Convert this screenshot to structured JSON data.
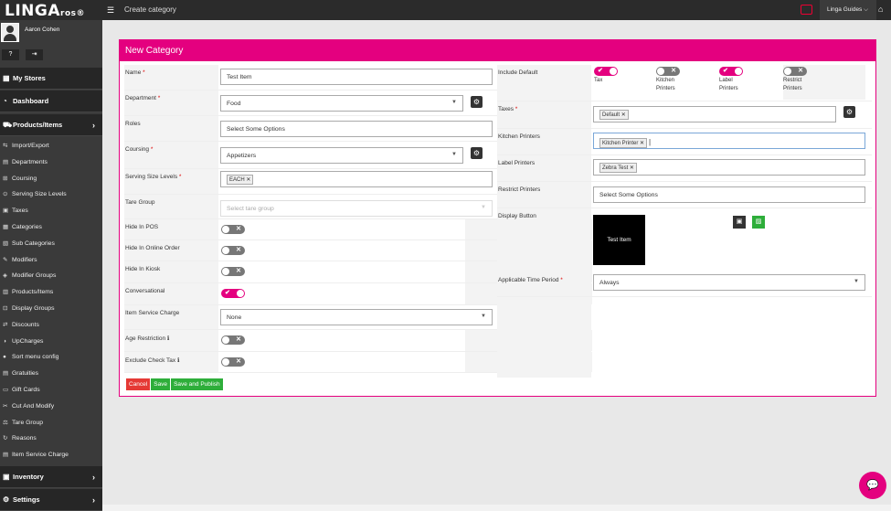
{
  "app": {
    "logo_main": "LINGA",
    "logo_sub": "ros",
    "page_title": "Create category",
    "guides": "Linga Guides"
  },
  "user": {
    "name": "Aaron Cohen"
  },
  "sidebar": {
    "main": [
      {
        "label": "My Stores"
      },
      {
        "label": "Dashboard"
      },
      {
        "label": "Products/Items"
      }
    ],
    "sub": [
      "Import/Export",
      "Departments",
      "Coursing",
      "Serving Size Levels",
      "Taxes",
      "Categories",
      "Sub Categories",
      "Modifiers",
      "Modifier Groups",
      "Products/Items",
      "Display Groups",
      "Discounts",
      "UpCharges",
      "Sort menu config",
      "Gratuities",
      "Gift Cards",
      "Cut And Modify",
      "Tare Group",
      "Reasons",
      "Item Service Charge"
    ],
    "bottom": [
      {
        "label": "Inventory"
      },
      {
        "label": "Settings"
      }
    ]
  },
  "form": {
    "heading": "New Category",
    "name": {
      "label": "Name",
      "value": "Test Item"
    },
    "department": {
      "label": "Department",
      "value": "Food"
    },
    "roles": {
      "label": "Roles",
      "placeholder": "Select Some Options"
    },
    "coursing": {
      "label": "Coursing",
      "value": "Appetizers"
    },
    "serving": {
      "label": "Serving Size Levels",
      "tag": "EACH"
    },
    "tare": {
      "label": "Tare Group",
      "placeholder": "Select tare group"
    },
    "hide_pos": {
      "label": "Hide In POS",
      "on": false
    },
    "hide_online": {
      "label": "Hide In Online Order",
      "on": false
    },
    "hide_kiosk": {
      "label": "Hide In Kiosk",
      "on": false
    },
    "conversational": {
      "label": "Conversational",
      "on": true
    },
    "service_charge": {
      "label": "Item Service Charge",
      "value": "None"
    },
    "age": {
      "label": "Age Restriction",
      "on": false
    },
    "exclude_tax": {
      "label": "Exclude Check Tax",
      "on": false
    },
    "include_default": {
      "label": "Include Default",
      "options": [
        {
          "label": "Tax",
          "on": true
        },
        {
          "label": "Kitchen Printers",
          "on": false
        },
        {
          "label": "Label Printers",
          "on": true
        },
        {
          "label": "Restrict Printers",
          "on": false
        }
      ]
    },
    "taxes": {
      "label": "Taxes",
      "tag": "Default"
    },
    "kitchen_printers": {
      "label": "Kitchen Printers",
      "tag": "Kitchen Printer"
    },
    "label_printers": {
      "label": "Label Printers",
      "tag": "Zebra Test"
    },
    "restrict_printers": {
      "label": "Restrict Printers",
      "placeholder": "Select Some Options"
    },
    "display_button": {
      "label": "Display Button",
      "tile_text": "Test Item"
    },
    "time_period": {
      "label": "Applicable Time Period",
      "value": "Always"
    },
    "buttons": {
      "cancel": "Cancel",
      "save": "Save",
      "publish": "Save and Publish"
    }
  },
  "colors": {
    "brand": "#e4007f",
    "sidebar": "#3a3a3a",
    "topbar": "#2b2b2b",
    "green": "#2eae3a",
    "red": "#e53935"
  }
}
